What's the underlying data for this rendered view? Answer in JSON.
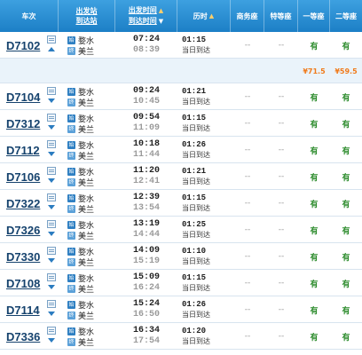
{
  "header": {
    "train": "车次",
    "station_top": "出发站",
    "station_bottom": "到达站",
    "time_top": "出发时间",
    "time_bottom": "到达时间",
    "duration": "历时",
    "business": "商务座",
    "special": "特等座",
    "first": "一等座",
    "second": "二等座"
  },
  "price_row": {
    "first": "¥71.5",
    "second": "¥59.5"
  },
  "trains": [
    {
      "no": "D7102",
      "expand": "up",
      "from": "婺水",
      "to": "美兰",
      "dep": "07:24",
      "arr": "08:39",
      "dur": "01:15",
      "note": "当日到达",
      "biz": "--",
      "spec": "--",
      "first": "有",
      "second": "有"
    },
    {
      "no": "D7104",
      "expand": "down",
      "from": "婺水",
      "to": "美兰",
      "dep": "09:24",
      "arr": "10:45",
      "dur": "01:21",
      "note": "当日到达",
      "biz": "--",
      "spec": "--",
      "first": "有",
      "second": "有"
    },
    {
      "no": "D7312",
      "expand": "down",
      "from": "婺水",
      "to": "美兰",
      "dep": "09:54",
      "arr": "11:09",
      "dur": "01:15",
      "note": "当日到达",
      "biz": "--",
      "spec": "--",
      "first": "有",
      "second": "有"
    },
    {
      "no": "D7112",
      "expand": "down",
      "from": "婺水",
      "to": "美兰",
      "dep": "10:18",
      "arr": "11:44",
      "dur": "01:26",
      "note": "当日到达",
      "biz": "--",
      "spec": "--",
      "first": "有",
      "second": "有"
    },
    {
      "no": "D7106",
      "expand": "down",
      "from": "婺水",
      "to": "美兰",
      "dep": "11:20",
      "arr": "12:41",
      "dur": "01:21",
      "note": "当日到达",
      "biz": "--",
      "spec": "--",
      "first": "有",
      "second": "有"
    },
    {
      "no": "D7322",
      "expand": "down",
      "from": "婺水",
      "to": "美兰",
      "dep": "12:39",
      "arr": "13:54",
      "dur": "01:15",
      "note": "当日到达",
      "biz": "--",
      "spec": "--",
      "first": "有",
      "second": "有"
    },
    {
      "no": "D7326",
      "expand": "down",
      "from": "婺水",
      "to": "美兰",
      "dep": "13:19",
      "arr": "14:44",
      "dur": "01:25",
      "note": "当日到达",
      "biz": "--",
      "spec": "--",
      "first": "有",
      "second": "有"
    },
    {
      "no": "D7330",
      "expand": "down",
      "from": "婺水",
      "to": "美兰",
      "dep": "14:09",
      "arr": "15:19",
      "dur": "01:10",
      "note": "当日到达",
      "biz": "--",
      "spec": "--",
      "first": "有",
      "second": "有"
    },
    {
      "no": "D7108",
      "expand": "down",
      "from": "婺水",
      "to": "美兰",
      "dep": "15:09",
      "arr": "16:24",
      "dur": "01:15",
      "note": "当日到达",
      "biz": "--",
      "spec": "--",
      "first": "有",
      "second": "有"
    },
    {
      "no": "D7114",
      "expand": "down",
      "from": "婺水",
      "to": "美兰",
      "dep": "15:24",
      "arr": "16:50",
      "dur": "01:26",
      "note": "当日到达",
      "biz": "--",
      "spec": "--",
      "first": "有",
      "second": "有"
    },
    {
      "no": "D7336",
      "expand": "down",
      "from": "婺水",
      "to": "美兰",
      "dep": "16:34",
      "arr": "17:54",
      "dur": "01:20",
      "note": "当日到达",
      "biz": "--",
      "spec": "--",
      "first": "有",
      "second": "有"
    }
  ],
  "colors": {
    "header": "#1c7fc6",
    "train_no": "#15426d",
    "available": "#2a8a2a",
    "price": "#f07a1a"
  },
  "icons": {
    "detail": "doc-icon",
    "expand": "triangle-icon"
  }
}
